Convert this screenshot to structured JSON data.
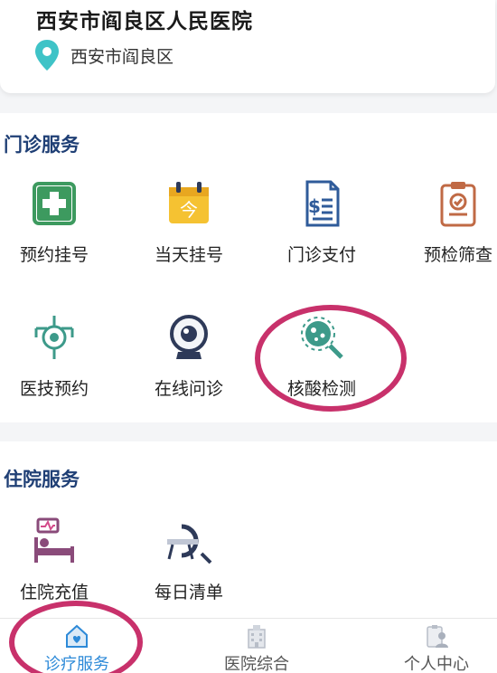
{
  "hospital": {
    "name": "西安市阎良区人民医院",
    "location": "西安市阎良区"
  },
  "outpatient": {
    "title": "门诊服务",
    "items": [
      {
        "label": "预约挂号",
        "icon": "green-cross-icon"
      },
      {
        "label": "当天挂号",
        "icon": "calendar-today-icon"
      },
      {
        "label": "门诊支付",
        "icon": "payment-bill-icon"
      },
      {
        "label": "预检筛查",
        "icon": "clipboard-check-icon"
      },
      {
        "label": "医技预约",
        "icon": "medical-tech-icon"
      },
      {
        "label": "在线问诊",
        "icon": "webcam-icon"
      },
      {
        "label": "核酸检测",
        "icon": "virus-search-icon"
      }
    ]
  },
  "inpatient": {
    "title": "住院服务",
    "items": [
      {
        "label": "住院充值",
        "icon": "hospital-bed-icon"
      },
      {
        "label": "每日清单",
        "icon": "ct-scanner-icon"
      }
    ]
  },
  "bottom_nav": {
    "items": [
      {
        "label": "诊疗服务",
        "icon": "house-heart-icon",
        "active": true
      },
      {
        "label": "医院综合",
        "icon": "hospital-building-icon",
        "active": false
      },
      {
        "label": "个人中心",
        "icon": "user-clipboard-icon",
        "active": false
      }
    ]
  },
  "colors": {
    "section_title": "#1f3f75",
    "highlight_mark": "#c8316b",
    "nav_active": "#2d8ad8",
    "location_pin": "#3fc3c7"
  }
}
